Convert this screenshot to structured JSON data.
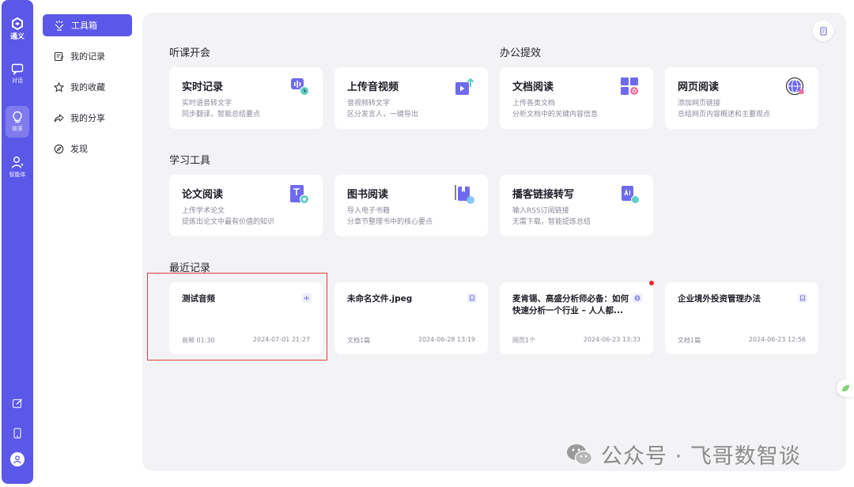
{
  "rail": {
    "brand": "通义",
    "items": [
      {
        "label": "对话"
      },
      {
        "label": "效率"
      },
      {
        "label": "智能体"
      }
    ]
  },
  "sidebar": {
    "items": [
      {
        "label": "工具箱",
        "icon": "toolbox-icon"
      },
      {
        "label": "我的记录",
        "icon": "record-icon"
      },
      {
        "label": "我的收藏",
        "icon": "star-icon"
      },
      {
        "label": "我的分享",
        "icon": "share-icon"
      },
      {
        "label": "发现",
        "icon": "compass-icon"
      }
    ]
  },
  "sections": {
    "lecture": "听课开会",
    "office": "办公提效",
    "study": "学习工具",
    "recent": "最近记录"
  },
  "tools": [
    {
      "title": "实时记录",
      "d1": "实时语音转文字",
      "d2": "同步翻译，智能总结要点"
    },
    {
      "title": "上传音视频",
      "d1": "音视频转文字",
      "d2": "区分发言人，一键导出"
    },
    {
      "title": "文档阅读",
      "d1": "上传各类文档",
      "d2": "分析文档中的关键内容信息"
    },
    {
      "title": "网页阅读",
      "d1": "添加网页链接",
      "d2": "总结网页内容概述和主要观点"
    },
    {
      "title": "论文阅读",
      "d1": "上传学术论文",
      "d2": "提炼出论文中最有价值的知识"
    },
    {
      "title": "图书阅读",
      "d1": "导入电子书籍",
      "d2": "分章节整理书中的核心要点"
    },
    {
      "title": "播客链接转写",
      "d1": "输入RSS订阅链接",
      "d2": "无需下载，智能提炼总结"
    }
  ],
  "recent": [
    {
      "title": "测试音频",
      "meta": "音频 01:30",
      "date": "2024-07-01 21:27"
    },
    {
      "title": "未命名文件.jpeg",
      "meta": "文档1篇",
      "date": "2024-06-28 13:19"
    },
    {
      "title": "麦肯锡、高盛分析师必备：如何快速分析一个行业 – 人人都...",
      "meta": "网页1个",
      "date": "2024-06-23 13:33"
    },
    {
      "title": "企业境外投资管理办法",
      "meta": "文档1篇",
      "date": "2024-06-23 12:56"
    }
  ],
  "watermark": "公众号 · 飞哥数智谈",
  "colors": {
    "accent": "#5b57e8",
    "highlight": "#e23b3b"
  }
}
